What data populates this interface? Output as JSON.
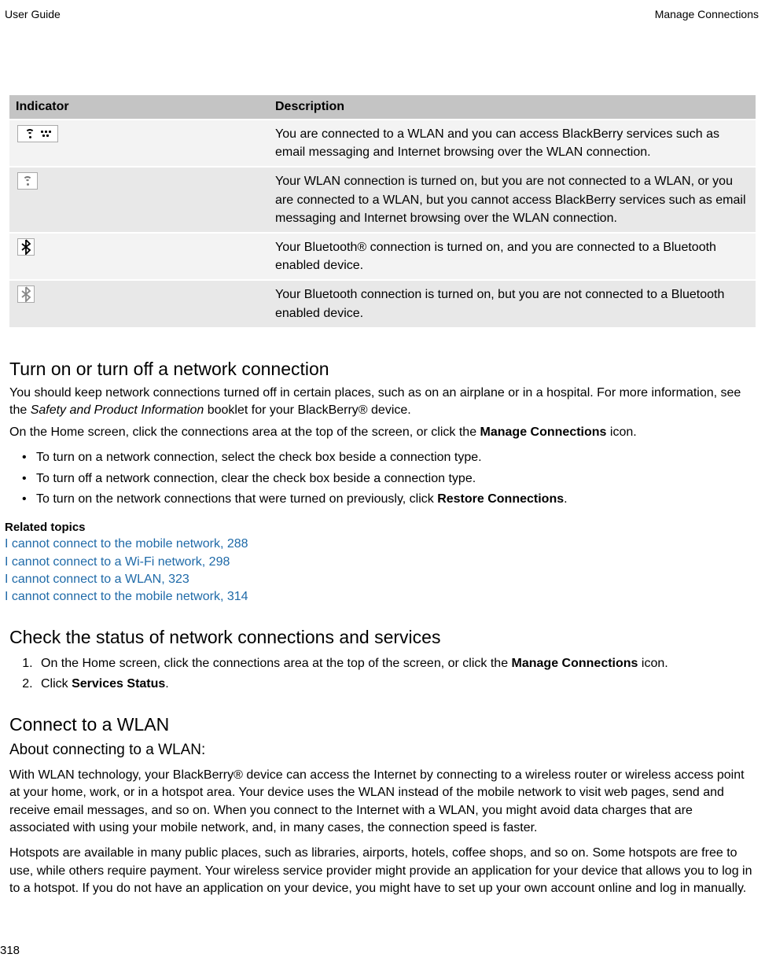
{
  "header": {
    "left": "User Guide",
    "right": "Manage Connections"
  },
  "table": {
    "headers": {
      "indicator": "Indicator",
      "description": "Description"
    },
    "rows": [
      {
        "icon": "wifi-bb-icon",
        "description": "You are connected to a WLAN and you can access BlackBerry services such as email messaging and Internet browsing over the WLAN connection."
      },
      {
        "icon": "wifi-dim-icon",
        "description": "Your WLAN connection is turned on, but you are not connected to a WLAN, or you are connected to a WLAN, but you cannot access BlackBerry services such as email messaging and Internet browsing over the WLAN connection."
      },
      {
        "icon": "bluetooth-on-icon",
        "description": "Your Bluetooth® connection is turned on, and you are connected to a Bluetooth enabled device."
      },
      {
        "icon": "bluetooth-dim-icon",
        "description": "Your Bluetooth connection is turned on, but you are not connected to a Bluetooth enabled device."
      }
    ]
  },
  "sections": {
    "turn_on_off": {
      "title": "Turn on or turn off a network connection",
      "para1_a": "You should keep network connections turned off in certain places, such as on an airplane or in a hospital. For more information, see the ",
      "para1_italic": "Safety and Product Information",
      "para1_b": " booklet for your BlackBerry® device.",
      "para2_a": "On the Home screen, click the connections area at the top of the screen, or click the ",
      "para2_bold": "Manage Connections",
      "para2_b": " icon.",
      "bullets": [
        "To turn on a network connection, select the check box beside a connection type.",
        "To turn off a network connection, clear the check box beside a connection type.",
        "To turn on the network connections that were turned on previously, click "
      ],
      "bullet3_bold": "Restore Connections",
      "bullet3_tail": "."
    },
    "related": {
      "heading": "Related topics",
      "links": [
        "I cannot connect to the mobile network, 288",
        "I cannot connect to a Wi-Fi network, 298",
        "I cannot connect to a WLAN, 323",
        "I cannot connect to the mobile network, 314"
      ]
    },
    "check_status": {
      "title": "Check the status of network connections and services",
      "step1_a": "On the Home screen, click the connections area at the top of the screen, or click the ",
      "step1_bold": "Manage Connections",
      "step1_b": " icon.",
      "step2_a": "Click ",
      "step2_bold": "Services Status",
      "step2_b": "."
    },
    "connect_wlan": {
      "title": "Connect to a WLAN",
      "subtitle": "About connecting to a WLAN:",
      "para1": "With WLAN technology, your BlackBerry® device can access the Internet by connecting to a wireless router or wireless access point at your home, work, or in a hotspot area. Your device uses the WLAN instead of the mobile network to visit web pages, send and receive email messages, and so on. When you connect to the Internet with a WLAN, you might avoid data charges that are associated with using your mobile network, and, in many cases, the connection speed is faster.",
      "para2": "Hotspots are available in many public places, such as libraries, airports, hotels, coffee shops, and so on. Some hotspots are free to use, while others require payment. Your wireless service provider might provide an application for your device that allows you to log in to a hotspot. If you do not have an application on your device, you might have to set up your own account online and log in manually."
    }
  },
  "page_number": "318"
}
